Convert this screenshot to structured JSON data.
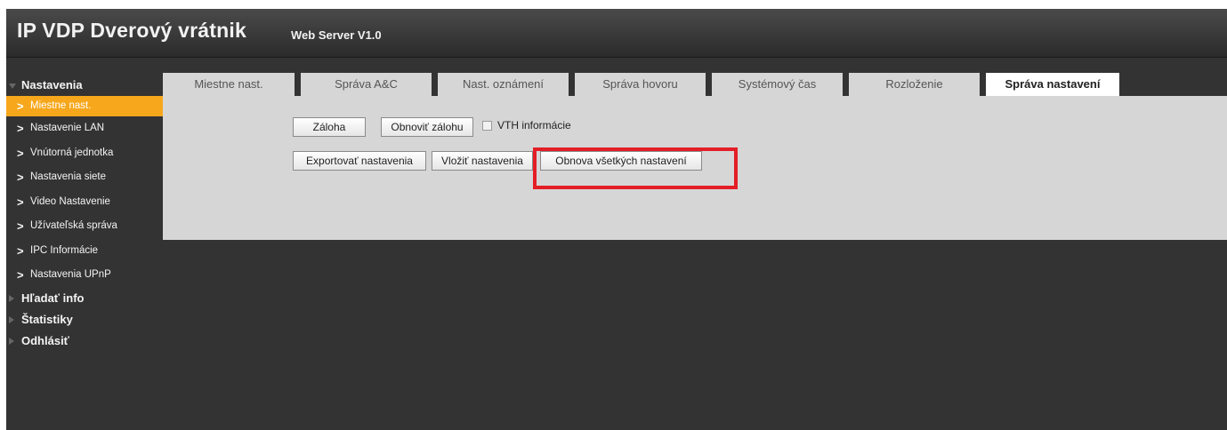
{
  "header": {
    "title": "IP VDP Dverový vrátnik",
    "subtitle": "Web Server V1.0"
  },
  "sidebar": {
    "section_main": "Nastavenia",
    "items": [
      {
        "label": "Miestne nast.",
        "active": true
      },
      {
        "label": "Nastavenie LAN"
      },
      {
        "label": "Vnútorná jednotka"
      },
      {
        "label": "Nastavenia siete"
      },
      {
        "label": "Video Nastavenie"
      },
      {
        "label": "Užívateľská správa"
      },
      {
        "label": "IPC Informácie"
      },
      {
        "label": "Nastavenia UPnP"
      }
    ],
    "sections_collapsed": [
      "Hľadať info",
      "Štatistiky",
      "Odhlásiť"
    ]
  },
  "tabs": [
    {
      "label": "Miestne nast."
    },
    {
      "label": "Správa A&C"
    },
    {
      "label": "Nast. oznámení"
    },
    {
      "label": "Správa hovoru"
    },
    {
      "label": "Systémový čas"
    },
    {
      "label": "Rozloženie"
    },
    {
      "label": "Správa nastavení",
      "active": true
    }
  ],
  "content": {
    "backup_button": "Záloha",
    "restore_backup_button": "Obnoviť zálohu",
    "vth_info_label": "VTH informácie",
    "vth_info_checked": false,
    "export_button": "Exportovať nastavenia",
    "import_button": "Vložiť nastavenia",
    "restore_all_button": "Obnova všetkých nastavení"
  },
  "colors": {
    "accent": "#f7a71c",
    "highlight": "#e41e26",
    "background": "#333333",
    "panel": "#d6d6d6"
  }
}
